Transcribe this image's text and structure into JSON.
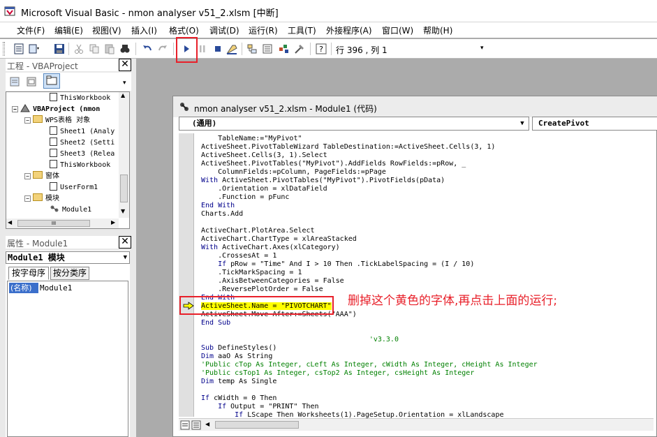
{
  "window": {
    "title": "Microsoft Visual Basic - nmon analyser v51_2.xlsm [中断]"
  },
  "menu": [
    "文件(F)",
    "编辑(E)",
    "视图(V)",
    "插入(I)",
    "格式(O)",
    "调试(D)",
    "运行(R)",
    "工具(T)",
    "外接程序(A)",
    "窗口(W)",
    "帮助(H)"
  ],
  "toolbar": {
    "position_text": "行 396 , 列 1"
  },
  "project_panel": {
    "title": "工程 - VBAProject",
    "tree": [
      "ThisWorkbook",
      "VBAProject (nmon",
      "WPS表格 对象",
      "Sheet1 (Analy",
      "Sheet2 (Setti",
      "Sheet3 (Relea",
      "ThisWorkbook",
      "窗体",
      "UserForm1",
      "模块",
      "Module1"
    ],
    "scroll_thumb_text": "III"
  },
  "properties_panel": {
    "title": "属性 - Module1",
    "selector": "Module1 模块",
    "tabs": [
      "按字母序",
      "按分类序"
    ],
    "rows": [
      {
        "key": "(名称)",
        "value": "Module1"
      }
    ]
  },
  "code_window": {
    "title": "nmon analyser v51_2.xlsm - Module1 (代码)",
    "object_combo": "(通用)",
    "proc_combo": "CreatePivot",
    "lines": [
      {
        "text": "    TableName:=\"MyPivot\"",
        "style": "plain"
      },
      {
        "text": "ActiveSheet.PivotTableWizard TableDestination:=ActiveSheet.Cells(3, 1)",
        "style": "plain"
      },
      {
        "text": "ActiveSheet.Cells(3, 1).Select",
        "style": "plain"
      },
      {
        "text": "ActiveSheet.PivotTables(\"MyPivot\").AddFields RowFields:=pRow, _",
        "style": "plain"
      },
      {
        "text": "    ColumnFields:=pColumn, PageFields:=pPage",
        "style": "plain"
      },
      {
        "text": "With ActiveSheet.PivotTables(\"MyPivot\").PivotFields(pData)",
        "style": "kwstart"
      },
      {
        "text": "    .Orientation = xlDataField",
        "style": "plain"
      },
      {
        "text": "    .Function = pFunc",
        "style": "plain"
      },
      {
        "text": "End With",
        "style": "kw"
      },
      {
        "text": "Charts.Add",
        "style": "plain"
      },
      {
        "text": "",
        "style": "plain"
      },
      {
        "text": "ActiveChart.PlotArea.Select",
        "style": "plain"
      },
      {
        "text": "ActiveChart.ChartType = xlAreaStacked",
        "style": "plain"
      },
      {
        "text": "With ActiveChart.Axes(xlCategory)",
        "style": "kwstart"
      },
      {
        "text": "    .CrossesAt = 1",
        "style": "plain"
      },
      {
        "text": "    If pRow = \"Time\" And I > 10 Then .TickLabelSpacing = (I / 10)",
        "style": "plain"
      },
      {
        "text": "    .TickMarkSpacing = 1",
        "style": "plain"
      },
      {
        "text": "    .AxisBetweenCategories = False",
        "style": "plain"
      },
      {
        "text": "    .ReversePlotOrder = False",
        "style": "plain"
      },
      {
        "text": "End With",
        "style": "kw"
      },
      {
        "text": "ActiveSheet.Name = \"PIVOTCHART\"",
        "style": "highlight"
      },
      {
        "text": "ActiveSheet.Move After:=Sheets(\"AAA\")",
        "style": "plain"
      },
      {
        "text": "End Sub",
        "style": "kw"
      },
      {
        "text": "",
        "style": "plain"
      },
      {
        "text": "                                        'v3.3.0",
        "style": "comment"
      },
      {
        "text": "Sub DefineStyles()",
        "style": "plain"
      },
      {
        "text": "Dim aaO As String",
        "style": "plain"
      },
      {
        "text": "'Public cTop As Integer, cLeft As Integer, cWidth As Integer, cHeight As Integer",
        "style": "comment"
      },
      {
        "text": "'Public csTop1 As Integer, csTop2 As Integer, csHeight As Integer",
        "style": "comment"
      },
      {
        "text": "Dim temp As Single",
        "style": "plain"
      },
      {
        "text": "",
        "style": "plain"
      },
      {
        "text": "If cWidth = 0 Then",
        "style": "plain"
      },
      {
        "text": "    If Output = \"PRINT\" Then",
        "style": "plain"
      },
      {
        "text": "        If LScape Then Worksheets(1).PageSetup.Orientation = xlLandscape",
        "style": "plain"
      }
    ]
  },
  "annotation": {
    "text": "删掉这个黄色的字体,再点击上面的运行;"
  },
  "colors": {
    "accent_red": "#e8202a",
    "highlight": "#ffff00",
    "keyword": "#00008b",
    "comment": "#008000"
  },
  "icons": [
    "vb-app-icon",
    "run-icon",
    "pause-icon",
    "stop-icon",
    "design-mode-icon",
    "project-explorer-icon",
    "properties-icon",
    "object-browser-icon",
    "toolbox-icon",
    "help-icon",
    "execution-arrow-icon"
  ]
}
